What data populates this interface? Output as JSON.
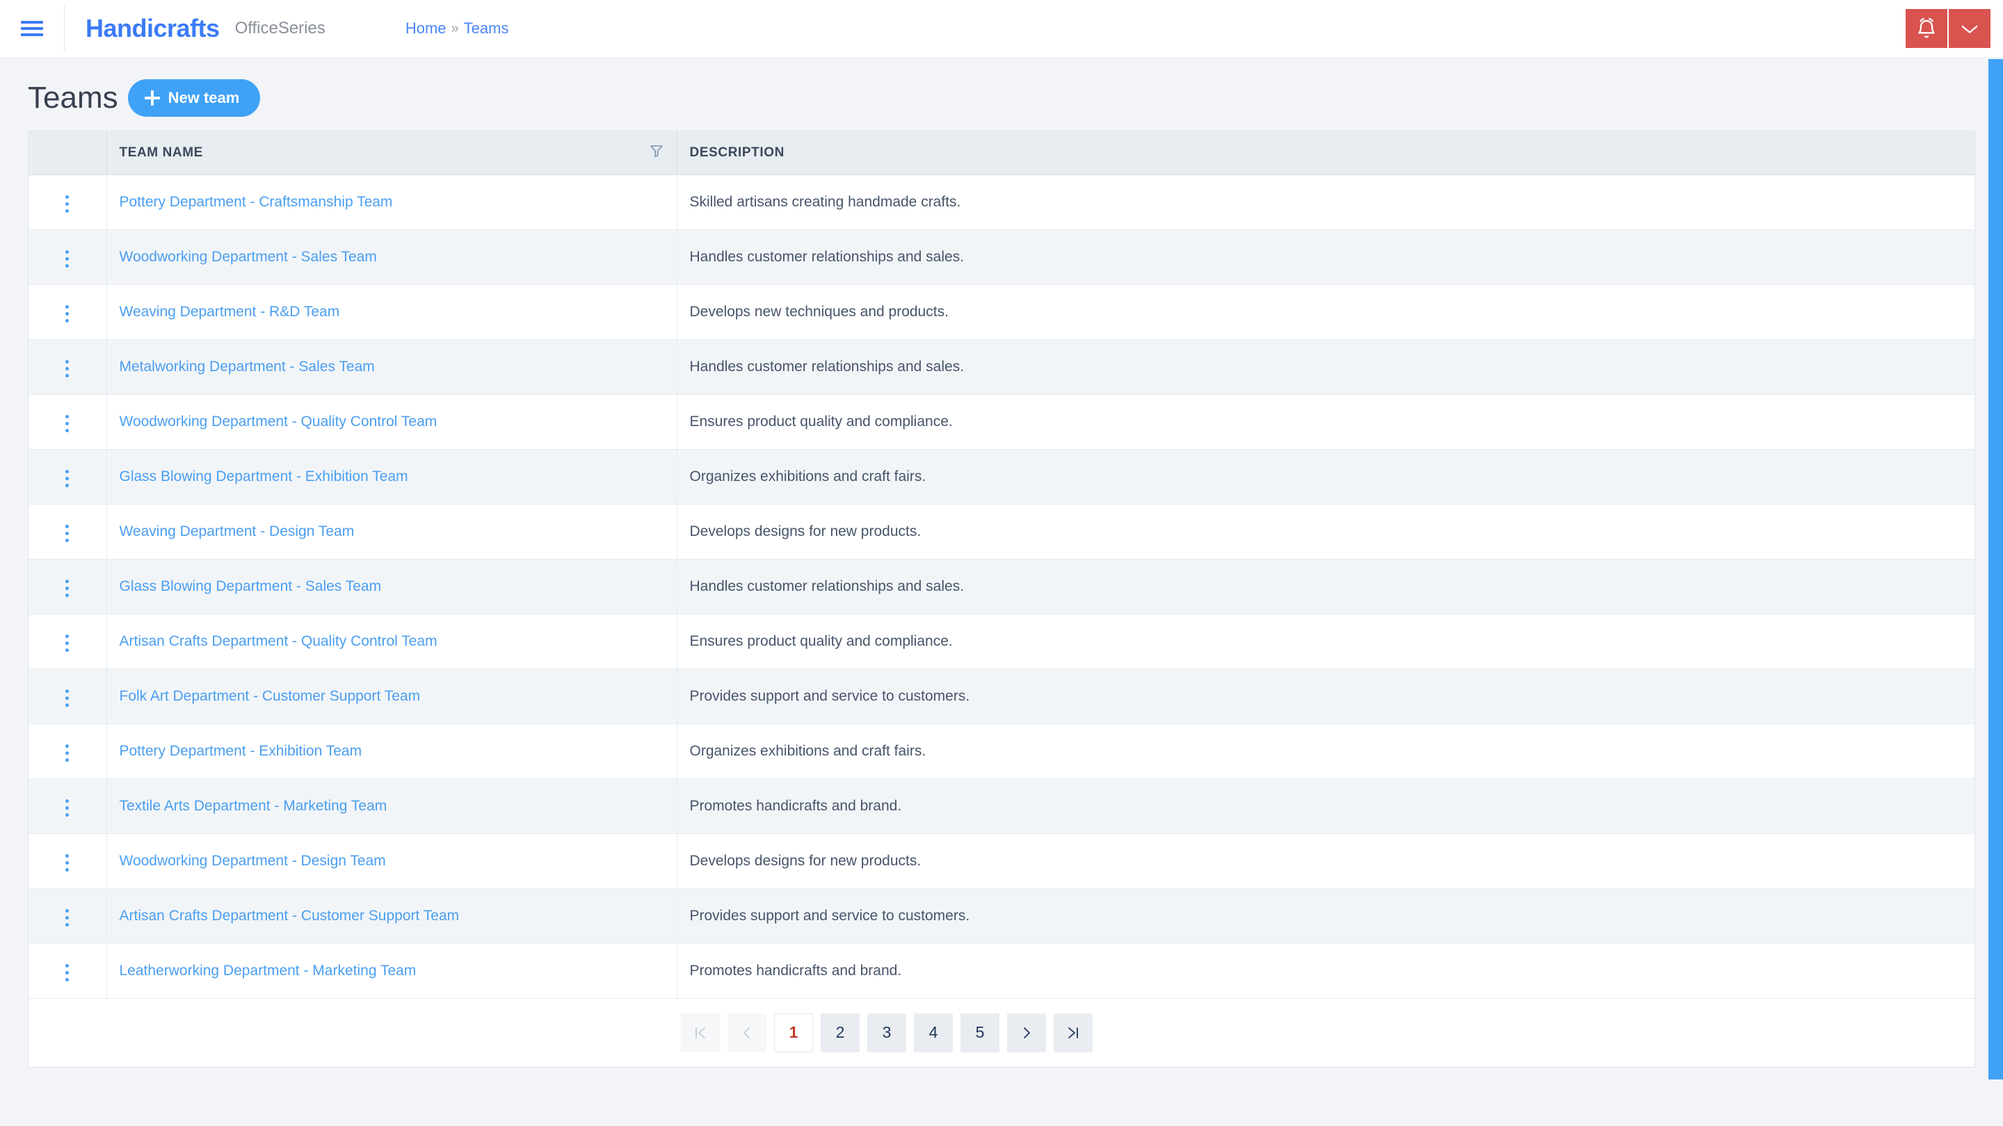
{
  "topbar": {
    "menu_icon": "hamburger-icon",
    "brand": "Handicrafts",
    "brand_sub": "OfficeSeries",
    "breadcrumb": {
      "home": "Home",
      "separator": "»",
      "current": "Teams"
    },
    "actions": {
      "notifications_icon": "bell-icon",
      "dropdown_icon": "chevron-down-icon"
    },
    "accent_blue": "#3b7bf6",
    "action_red": "#d9534f"
  },
  "page": {
    "title": "Teams",
    "new_button": "New team",
    "new_button_icon": "plus-icon",
    "button_blue": "#3fa2f7"
  },
  "table": {
    "columns": [
      {
        "key": "menu",
        "label": ""
      },
      {
        "key": "name",
        "label": "TEAM NAME",
        "filter_icon": "filter-icon"
      },
      {
        "key": "description",
        "label": "DESCRIPTION"
      }
    ],
    "row_menu_icon": "kebab-menu-icon",
    "rows": [
      {
        "name": "Pottery Department - Craftsmanship Team",
        "description": "Skilled artisans creating handmade crafts."
      },
      {
        "name": "Woodworking Department - Sales Team",
        "description": "Handles customer relationships and sales."
      },
      {
        "name": "Weaving Department - R&D Team",
        "description": "Develops new techniques and products."
      },
      {
        "name": "Metalworking Department - Sales Team",
        "description": "Handles customer relationships and sales."
      },
      {
        "name": "Woodworking Department - Quality Control Team",
        "description": "Ensures product quality and compliance."
      },
      {
        "name": "Glass Blowing Department - Exhibition Team",
        "description": "Organizes exhibitions and craft fairs."
      },
      {
        "name": "Weaving Department - Design Team",
        "description": "Develops designs for new products."
      },
      {
        "name": "Glass Blowing Department - Sales Team",
        "description": "Handles customer relationships and sales."
      },
      {
        "name": "Artisan Crafts Department - Quality Control Team",
        "description": "Ensures product quality and compliance."
      },
      {
        "name": "Folk Art Department - Customer Support Team",
        "description": "Provides support and service to customers."
      },
      {
        "name": "Pottery Department - Exhibition Team",
        "description": "Organizes exhibitions and craft fairs."
      },
      {
        "name": "Textile Arts Department - Marketing Team",
        "description": "Promotes handicrafts and brand."
      },
      {
        "name": "Woodworking Department - Design Team",
        "description": "Develops designs for new products."
      },
      {
        "name": "Artisan Crafts Department - Customer Support Team",
        "description": "Provides support and service to customers."
      },
      {
        "name": "Leatherworking Department - Marketing Team",
        "description": "Promotes handicrafts and brand."
      }
    ]
  },
  "pagination": {
    "first_label": "|<",
    "prev_label": "‹",
    "pages": [
      "1",
      "2",
      "3",
      "4",
      "5"
    ],
    "current_page": "1",
    "next_label": "›",
    "last_label": ">|",
    "active_color": "#c0392b"
  }
}
